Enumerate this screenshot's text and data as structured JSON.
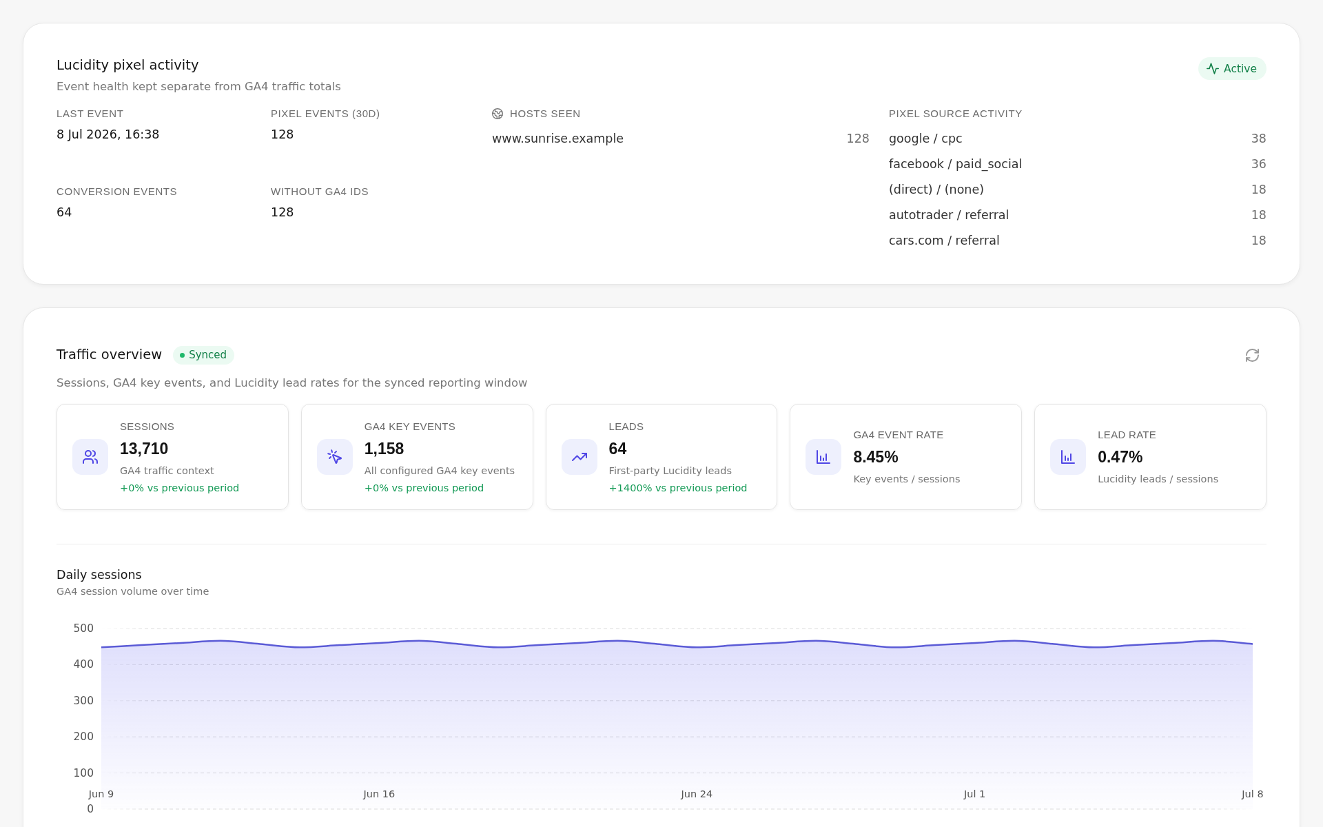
{
  "pixel_activity": {
    "title": "Lucidity pixel activity",
    "subtitle": "Event health kept separate from GA4 traffic totals",
    "status_badge": {
      "label": "Active"
    },
    "metrics": [
      {
        "label": "LAST EVENT",
        "value": "8 Jul 2026, 16:38"
      },
      {
        "label": "PIXEL EVENTS (30D)",
        "value": "128"
      },
      {
        "label": "CONVERSION EVENTS",
        "value": "64"
      },
      {
        "label": "WITHOUT GA4 IDS",
        "value": "128"
      }
    ],
    "hosts_seen": {
      "label": "HOSTS SEEN",
      "rows": [
        {
          "host": "www.sunrise.example",
          "count": "128"
        }
      ]
    },
    "pixel_source_activity": {
      "label": "PIXEL SOURCE ACTIVITY",
      "rows": [
        {
          "source": "google / cpc",
          "count": "38"
        },
        {
          "source": "facebook / paid_social",
          "count": "36"
        },
        {
          "source": "(direct) / (none)",
          "count": "18"
        },
        {
          "source": "autotrader / referral",
          "count": "18"
        },
        {
          "source": "cars.com / referral",
          "count": "18"
        }
      ]
    }
  },
  "traffic_overview": {
    "title": "Traffic overview",
    "sync_badge": {
      "label": "Synced"
    },
    "description": "Sessions, GA4 key events, and Lucidity lead rates for the synced reporting window",
    "stats": [
      {
        "label": "SESSIONS",
        "value": "13,710",
        "caption": "GA4 traffic context",
        "change": "+0% vs previous period"
      },
      {
        "label": "GA4 KEY EVENTS",
        "value": "1,158",
        "caption": "All configured GA4 key events",
        "change": "+0% vs previous period"
      },
      {
        "label": "LEADS",
        "value": "64",
        "caption": "First-party Lucidity leads",
        "change": "+1400% vs previous period"
      },
      {
        "label": "GA4 EVENT RATE",
        "value": "8.45%",
        "caption": "Key events / sessions"
      },
      {
        "label": "LEAD RATE",
        "value": "0.47%",
        "caption": "Lucidity leads / sessions"
      }
    ],
    "daily_sessions": {
      "title": "Daily sessions",
      "subtitle": "GA4 session volume over time",
      "chart_data": {
        "type": "area",
        "categories": [
          "Jun 9",
          null,
          null,
          null,
          null,
          null,
          null,
          "Jun 16",
          null,
          null,
          null,
          null,
          null,
          null,
          null,
          "Jun 24",
          null,
          null,
          null,
          null,
          null,
          null,
          "Jul 1",
          null,
          null,
          null,
          null,
          null,
          null,
          "Jul 8"
        ],
        "values": [
          448,
          454,
          460,
          466,
          457,
          448,
          454,
          460,
          466,
          457,
          448,
          454,
          460,
          466,
          457,
          448,
          454,
          460,
          466,
          457,
          448,
          454,
          460,
          466,
          457,
          448,
          454,
          460,
          466,
          457
        ],
        "ylim": [
          0,
          500
        ],
        "yticks": [
          0,
          100,
          200,
          300,
          400,
          500
        ],
        "grid": true
      }
    }
  }
}
